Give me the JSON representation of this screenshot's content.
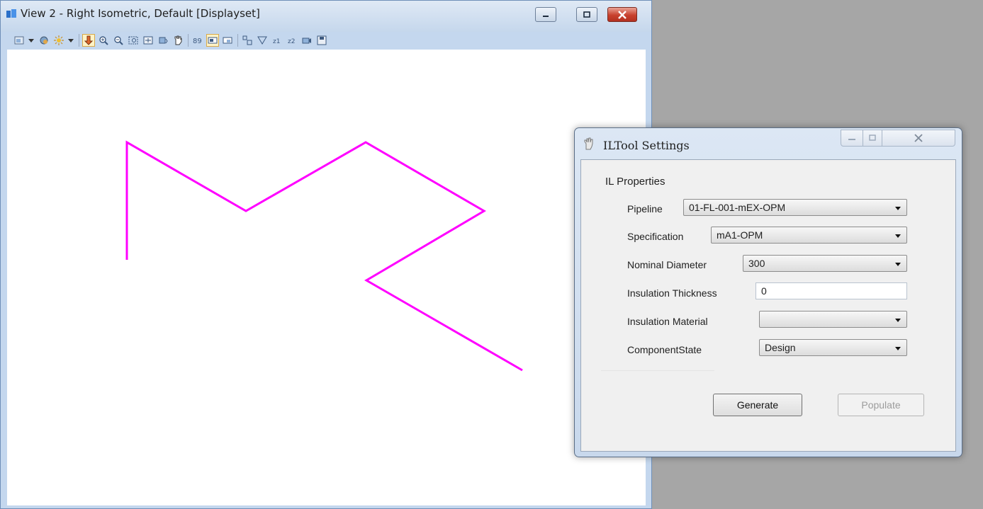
{
  "view_window": {
    "title": "View 2 - Right Isometric, Default [Displayset]",
    "controls": {
      "minimize": "minimize-icon",
      "maximize": "maximize-icon",
      "close": "close-icon"
    },
    "toolbar": [
      "view-attributes-icon",
      "dropdown-arrow",
      "view-display-icon",
      "lighting-icon",
      "dropdown-arrow",
      "update-view-icon",
      "zoom-in-icon",
      "zoom-out-icon",
      "window-area-icon",
      "fit-view-icon",
      "rotate-view-icon",
      "pan-view-icon",
      "view-previous-icon",
      "view-next-icon",
      "copy-view-icon",
      "clip-volume-icon",
      "clip-mask-icon",
      "front-clip-icon",
      "back-clip-icon",
      "camera-icon",
      "save-view-icon"
    ],
    "canvas": {
      "polyline_color": "#ff00ff",
      "background": "#ffffff"
    }
  },
  "dialog": {
    "title": "ILTool Settings",
    "group_title": "IL Properties",
    "fields": {
      "pipeline": {
        "label": "Pipeline",
        "value": "01-FL-001-mEX-OPM"
      },
      "specification": {
        "label": "Specification",
        "value": "mA1-OPM"
      },
      "nominal_diameter": {
        "label": "Nominal Diameter",
        "value": "300"
      },
      "insulation_thickness": {
        "label": "Insulation Thickness",
        "value": "0"
      },
      "insulation_material": {
        "label": "Insulation Material",
        "value": ""
      },
      "component_state": {
        "label": "ComponentState",
        "value": "Design"
      }
    },
    "buttons": {
      "generate": "Generate",
      "populate": "Populate"
    }
  }
}
